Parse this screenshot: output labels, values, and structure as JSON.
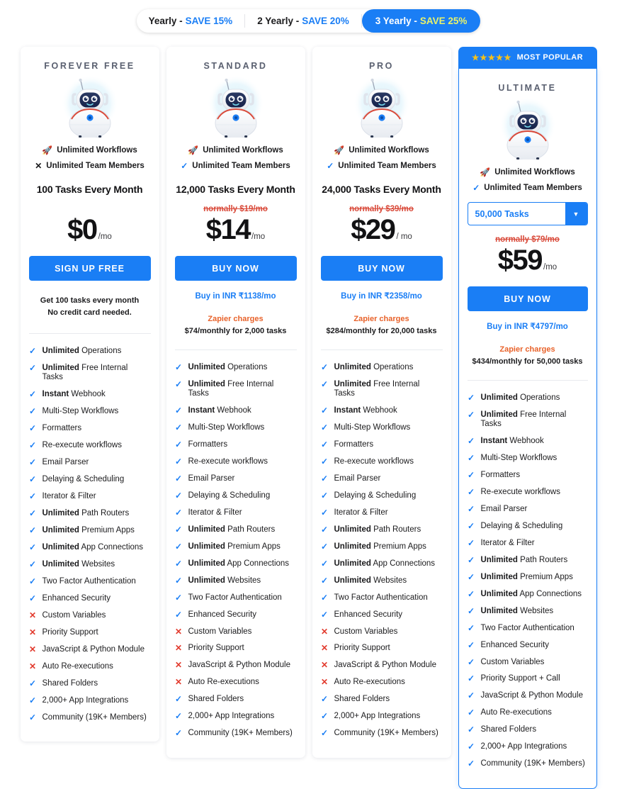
{
  "billing": {
    "tabs": [
      {
        "label": "Yearly - ",
        "save": "SAVE 15%",
        "active": false
      },
      {
        "label": "2 Yearly - ",
        "save": "SAVE 20%",
        "active": false
      },
      {
        "label": "3 Yearly - ",
        "save": "SAVE 25%",
        "active": true
      }
    ]
  },
  "popular_badge": {
    "stars": "★★★★★",
    "label": "MOST POPULAR"
  },
  "glyphs": {
    "rocket": "🚀",
    "check": "✓",
    "cross": "✕",
    "chevron_down": "▼"
  },
  "colors": {
    "accent_blue": "#1a7ef5",
    "check_blue": "#1a7ef5",
    "cross_red": "#e23b2e",
    "strike_red": "#d94a3a",
    "zapier_orange": "#e8622a",
    "star_gold": "#f5c11a",
    "title_gray": "#5a6070"
  },
  "plans": [
    {
      "name": "FOREVER FREE",
      "popular": false,
      "workflows": "Unlimited Workflows",
      "team_members": "Unlimited Team Members",
      "team_members_included": false,
      "tasks_line": "100 Tasks Every Month",
      "has_select": false,
      "normally": "",
      "price": "$0",
      "per": "/mo",
      "cta": "SIGN UP FREE",
      "inr": "",
      "zapier_title": "",
      "zapier_sub": "",
      "free_note_1": "Get 100 tasks every month",
      "free_note_2": "No credit card needed.",
      "features": [
        {
          "bold": "Unlimited",
          "text": "Operations",
          "included": true
        },
        {
          "bold": "Unlimited",
          "text": "Free Internal Tasks",
          "included": true
        },
        {
          "bold": "Instant",
          "text": "Webhook",
          "included": true
        },
        {
          "bold": "",
          "text": "Multi-Step Workflows",
          "included": true
        },
        {
          "bold": "",
          "text": "Formatters",
          "included": true
        },
        {
          "bold": "",
          "text": "Re-execute workflows",
          "included": true
        },
        {
          "bold": "",
          "text": "Email Parser",
          "included": true
        },
        {
          "bold": "",
          "text": "Delaying & Scheduling",
          "included": true
        },
        {
          "bold": "",
          "text": "Iterator & Filter",
          "included": true
        },
        {
          "bold": "Unlimited",
          "text": "Path Routers",
          "included": true
        },
        {
          "bold": "Unlimited",
          "text": "Premium Apps",
          "included": true
        },
        {
          "bold": "Unlimited",
          "text": "App Connections",
          "included": true
        },
        {
          "bold": "Unlimited",
          "text": "Websites",
          "included": true
        },
        {
          "bold": "",
          "text": "Two Factor Authentication",
          "included": true
        },
        {
          "bold": "",
          "text": "Enhanced Security",
          "included": true
        },
        {
          "bold": "",
          "text": "Custom Variables",
          "included": false
        },
        {
          "bold": "",
          "text": "Priority Support",
          "included": false
        },
        {
          "bold": "",
          "text": "JavaScript & Python Module",
          "included": false
        },
        {
          "bold": "",
          "text": "Auto Re-executions",
          "included": false
        },
        {
          "bold": "",
          "text": "Shared Folders",
          "included": true
        },
        {
          "bold": "",
          "text": "2,000+ App Integrations",
          "included": true
        },
        {
          "bold": "",
          "text": "Community (19K+ Members)",
          "included": true
        }
      ]
    },
    {
      "name": "STANDARD",
      "popular": false,
      "workflows": "Unlimited Workflows",
      "team_members": "Unlimited Team Members",
      "team_members_included": true,
      "tasks_line": "12,000 Tasks Every Month",
      "has_select": false,
      "normally": "normally $19/mo",
      "price": "$14",
      "per": "/mo",
      "cta": "BUY NOW",
      "inr": "Buy in INR ₹1138/mo",
      "zapier_title": "Zapier charges",
      "zapier_sub": "$74/monthly for 2,000 tasks",
      "free_note_1": "",
      "free_note_2": "",
      "features": [
        {
          "bold": "Unlimited",
          "text": "Operations",
          "included": true
        },
        {
          "bold": "Unlimited",
          "text": "Free Internal Tasks",
          "included": true
        },
        {
          "bold": "Instant",
          "text": "Webhook",
          "included": true
        },
        {
          "bold": "",
          "text": "Multi-Step Workflows",
          "included": true
        },
        {
          "bold": "",
          "text": "Formatters",
          "included": true
        },
        {
          "bold": "",
          "text": "Re-execute workflows",
          "included": true
        },
        {
          "bold": "",
          "text": "Email Parser",
          "included": true
        },
        {
          "bold": "",
          "text": "Delaying & Scheduling",
          "included": true
        },
        {
          "bold": "",
          "text": "Iterator & Filter",
          "included": true
        },
        {
          "bold": "Unlimited",
          "text": "Path Routers",
          "included": true
        },
        {
          "bold": "Unlimited",
          "text": "Premium Apps",
          "included": true
        },
        {
          "bold": "Unlimited",
          "text": "App Connections",
          "included": true
        },
        {
          "bold": "Unlimited",
          "text": "Websites",
          "included": true
        },
        {
          "bold": "",
          "text": "Two Factor Authentication",
          "included": true
        },
        {
          "bold": "",
          "text": "Enhanced Security",
          "included": true
        },
        {
          "bold": "",
          "text": "Custom Variables",
          "included": false
        },
        {
          "bold": "",
          "text": "Priority Support",
          "included": false
        },
        {
          "bold": "",
          "text": "JavaScript & Python Module",
          "included": false
        },
        {
          "bold": "",
          "text": "Auto Re-executions",
          "included": false
        },
        {
          "bold": "",
          "text": "Shared Folders",
          "included": true
        },
        {
          "bold": "",
          "text": "2,000+ App Integrations",
          "included": true
        },
        {
          "bold": "",
          "text": "Community (19K+ Members)",
          "included": true
        }
      ]
    },
    {
      "name": "PRO",
      "popular": false,
      "workflows": "Unlimited Workflows",
      "team_members": "Unlimited Team Members",
      "team_members_included": true,
      "tasks_line": "24,000 Tasks Every Month",
      "has_select": false,
      "normally": "normally $39/mo",
      "price": "$29",
      "per": "/ mo",
      "cta": "BUY NOW",
      "inr": "Buy in INR ₹2358/mo",
      "zapier_title": "Zapier charges",
      "zapier_sub": "$284/monthly for 20,000 tasks",
      "free_note_1": "",
      "free_note_2": "",
      "features": [
        {
          "bold": "Unlimited",
          "text": "Operations",
          "included": true
        },
        {
          "bold": "Unlimited",
          "text": "Free Internal Tasks",
          "included": true
        },
        {
          "bold": "Instant",
          "text": "Webhook",
          "included": true
        },
        {
          "bold": "",
          "text": "Multi-Step Workflows",
          "included": true
        },
        {
          "bold": "",
          "text": "Formatters",
          "included": true
        },
        {
          "bold": "",
          "text": "Re-execute workflows",
          "included": true
        },
        {
          "bold": "",
          "text": "Email Parser",
          "included": true
        },
        {
          "bold": "",
          "text": "Delaying & Scheduling",
          "included": true
        },
        {
          "bold": "",
          "text": "Iterator & Filter",
          "included": true
        },
        {
          "bold": "Unlimited",
          "text": "Path Routers",
          "included": true
        },
        {
          "bold": "Unlimited",
          "text": "Premium Apps",
          "included": true
        },
        {
          "bold": "Unlimited",
          "text": "App Connections",
          "included": true
        },
        {
          "bold": "Unlimited",
          "text": "Websites",
          "included": true
        },
        {
          "bold": "",
          "text": "Two Factor Authentication",
          "included": true
        },
        {
          "bold": "",
          "text": "Enhanced Security",
          "included": true
        },
        {
          "bold": "",
          "text": "Custom Variables",
          "included": false
        },
        {
          "bold": "",
          "text": "Priority Support",
          "included": false
        },
        {
          "bold": "",
          "text": "JavaScript & Python Module",
          "included": false
        },
        {
          "bold": "",
          "text": "Auto Re-executions",
          "included": false
        },
        {
          "bold": "",
          "text": "Shared Folders",
          "included": true
        },
        {
          "bold": "",
          "text": "2,000+ App Integrations",
          "included": true
        },
        {
          "bold": "",
          "text": "Community (19K+ Members)",
          "included": true
        }
      ]
    },
    {
      "name": "ULTIMATE",
      "popular": true,
      "workflows": "Unlimited Workflows",
      "team_members": "Unlimited Team Members",
      "team_members_included": true,
      "tasks_line": "",
      "has_select": true,
      "select_value": "50,000 Tasks",
      "normally": "normally $79/mo",
      "price": "$59",
      "per": "/mo",
      "cta": "BUY NOW",
      "inr": "Buy in INR ₹4797/mo",
      "zapier_title": "Zapier charges",
      "zapier_sub": "$434/monthly for 50,000 tasks",
      "free_note_1": "",
      "free_note_2": "",
      "features": [
        {
          "bold": "Unlimited",
          "text": "Operations",
          "included": true
        },
        {
          "bold": "Unlimited",
          "text": "Free Internal Tasks",
          "included": true
        },
        {
          "bold": "Instant",
          "text": "Webhook",
          "included": true
        },
        {
          "bold": "",
          "text": "Multi-Step Workflows",
          "included": true
        },
        {
          "bold": "",
          "text": "Formatters",
          "included": true
        },
        {
          "bold": "",
          "text": "Re-execute workflows",
          "included": true
        },
        {
          "bold": "",
          "text": "Email Parser",
          "included": true
        },
        {
          "bold": "",
          "text": "Delaying & Scheduling",
          "included": true
        },
        {
          "bold": "",
          "text": "Iterator & Filter",
          "included": true
        },
        {
          "bold": "Unlimited",
          "text": "Path Routers",
          "included": true
        },
        {
          "bold": "Unlimited",
          "text": "Premium Apps",
          "included": true
        },
        {
          "bold": "Unlimited",
          "text": "App Connections",
          "included": true
        },
        {
          "bold": "Unlimited",
          "text": "Websites",
          "included": true
        },
        {
          "bold": "",
          "text": "Two Factor Authentication",
          "included": true
        },
        {
          "bold": "",
          "text": "Enhanced Security",
          "included": true
        },
        {
          "bold": "",
          "text": "Custom Variables",
          "included": true
        },
        {
          "bold": "",
          "text": "Priority Support + Call",
          "included": true
        },
        {
          "bold": "",
          "text": "JavaScript & Python Module",
          "included": true
        },
        {
          "bold": "",
          "text": "Auto Re-executions",
          "included": true
        },
        {
          "bold": "",
          "text": "Shared Folders",
          "included": true
        },
        {
          "bold": "",
          "text": "2,000+ App Integrations",
          "included": true
        },
        {
          "bold": "",
          "text": "Community (19K+ Members)",
          "included": true
        }
      ]
    }
  ]
}
